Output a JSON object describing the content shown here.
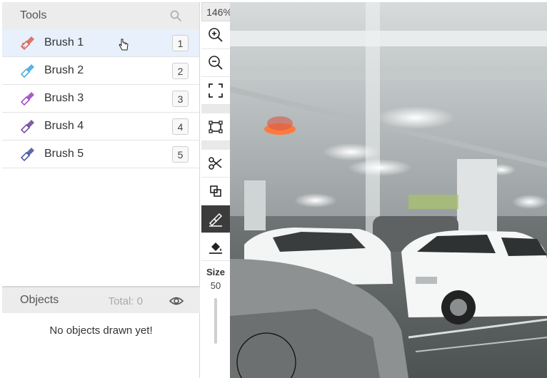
{
  "tools_panel": {
    "title": "Tools",
    "search_icon": "search-icon",
    "items": [
      {
        "label": "Brush 1",
        "key": "1",
        "color": "#e05a4f",
        "active": true
      },
      {
        "label": "Brush 2",
        "key": "2",
        "color": "#3aa7e0",
        "active": false
      },
      {
        "label": "Brush 3",
        "key": "3",
        "color": "#9b3fc4",
        "active": false
      },
      {
        "label": "Brush 4",
        "key": "4",
        "color": "#6b3fa0",
        "active": false
      },
      {
        "label": "Brush 5",
        "key": "5",
        "color": "#3f4fa0",
        "active": false
      }
    ]
  },
  "objects_panel": {
    "title": "Objects",
    "total_label": "Total: 0",
    "empty_message": "No objects drawn yet!",
    "visibility_icon": "eye-icon"
  },
  "toolbar": {
    "zoom_label": "146%",
    "buttons": [
      "zoom-in-icon",
      "zoom-out-icon",
      "fit-screen-icon",
      "crop-box-icon",
      "scissors-icon",
      "layers-icon",
      "brush-icon",
      "fill-icon"
    ],
    "selected": "brush-icon",
    "size_label": "Size",
    "size_value": "50"
  },
  "colors": {
    "active_row": "#e7f0fb",
    "header_bg": "#ececec",
    "selected_tool": "#3c3c3c"
  }
}
